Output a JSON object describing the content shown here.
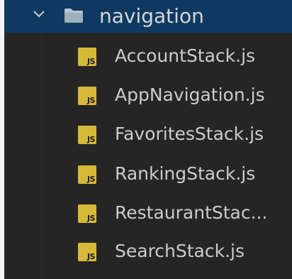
{
  "explorer": {
    "folder": {
      "name": "navigation",
      "icon": "chevron-down-icon",
      "folder_icon": "folder-icon"
    },
    "files": [
      {
        "name": "AccountStack.js",
        "icon_label": "JS"
      },
      {
        "name": "AppNavigation.js",
        "icon_label": "JS"
      },
      {
        "name": "FavoritesStack.js",
        "icon_label": "JS"
      },
      {
        "name": "RankingStack.js",
        "icon_label": "JS"
      },
      {
        "name": "RestaurantStac...",
        "icon_label": "JS"
      },
      {
        "name": "SearchStack.js",
        "icon_label": "JS"
      }
    ]
  },
  "colors": {
    "background": "#252526",
    "selected_row": "#0e3a61",
    "js_icon": "#d7b93a",
    "text": "#cccccc"
  }
}
